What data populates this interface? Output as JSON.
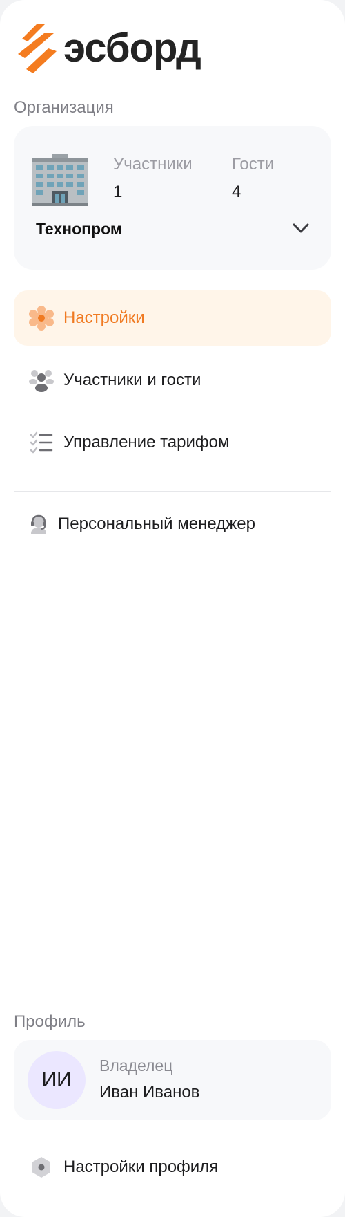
{
  "brand": {
    "name": "эсборд",
    "accent": "#f47c20",
    "text_color": "#242424"
  },
  "organization": {
    "section_label": "Организация",
    "name": "Технопром",
    "participants_label": "Участники",
    "participants_count": "1",
    "guests_label": "Гости",
    "guests_count": "4",
    "icon": "building-icon"
  },
  "nav": {
    "items": [
      {
        "label": "Настройки",
        "icon": "gear-icon",
        "active": true
      },
      {
        "label": "Участники и гости",
        "icon": "people-icon",
        "active": false
      },
      {
        "label": "Управление тарифом",
        "icon": "checklist-icon",
        "active": false
      }
    ],
    "manager": {
      "label": "Персональный менеджер",
      "icon": "headset-icon"
    }
  },
  "profile": {
    "section_label": "Профиль",
    "initials": "ИИ",
    "role": "Владелец",
    "name": "Иван Иванов",
    "settings_label": "Настройки профиля",
    "settings_icon": "hexagon-icon"
  },
  "colors": {
    "active_bg": "#fff5e9",
    "active_text": "#f07a22",
    "card_bg": "#f7f8fa",
    "avatar_bg": "#ebe7ff"
  }
}
